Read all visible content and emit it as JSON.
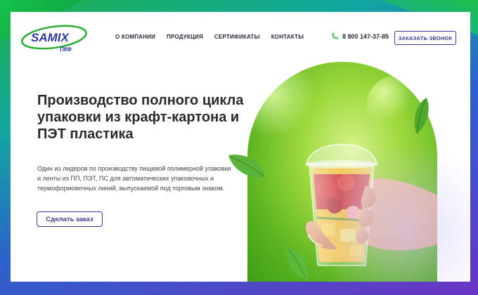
{
  "logo": {
    "brand": "SAMIX",
    "sub": "ПКФ"
  },
  "nav": [
    {
      "label": "О КОМПАНИИ"
    },
    {
      "label": "ПРОДУКЦИЯ"
    },
    {
      "label": "СЕРТИФИКАТЫ"
    },
    {
      "label": "КОНТАКТЫ"
    }
  ],
  "header": {
    "phone": "8 800 147-37-85",
    "phone_icon": "phone-icon",
    "call_button": "ЗАКАЗАТЬ ЗВОНОК"
  },
  "hero": {
    "title": "Производство полного цикла упаковки из крафт-картона и ПЭТ пластика",
    "description": "Один из лидеров по производству пищевой полимерной упаковки и ленты из ПП, ПЭТ, ПС для автоматических упаковочных и термоформовочных линий, выпускаемой под торговым знаком.",
    "order_button": "Сделать заказ"
  },
  "colors": {
    "accent": "#3b3a8f",
    "brand_blue": "#2b3a9e",
    "brand_green": "#2fae3a",
    "text": "#2b2b2b"
  }
}
